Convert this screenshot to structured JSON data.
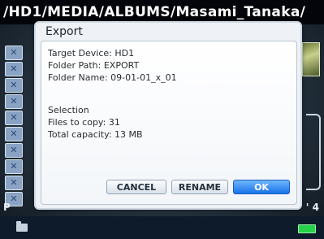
{
  "path_bar": {
    "text": "/HD1/MEDIA/ALBUMS/Masami_Tanaka/"
  },
  "background": {
    "p_label": "P",
    "count_label": "' 4"
  },
  "dialog": {
    "title": "Export",
    "target_device": "Target Device: HD1",
    "folder_path": "Folder Path: EXPORT",
    "folder_name": "Folder Name: 09-01-01_x_01",
    "selection_heading": "Selection",
    "files_to_copy": "Files to copy: 31",
    "total_capacity": "Total capacity: 13 MB",
    "cancel_label": "CANCEL",
    "rename_label": "RENAME",
    "ok_label": "OK"
  },
  "icons": {
    "folder": "folder-icon",
    "battery": "battery-icon"
  },
  "colors": {
    "ok_button": "#1873e8",
    "battery": "#27d14a"
  }
}
